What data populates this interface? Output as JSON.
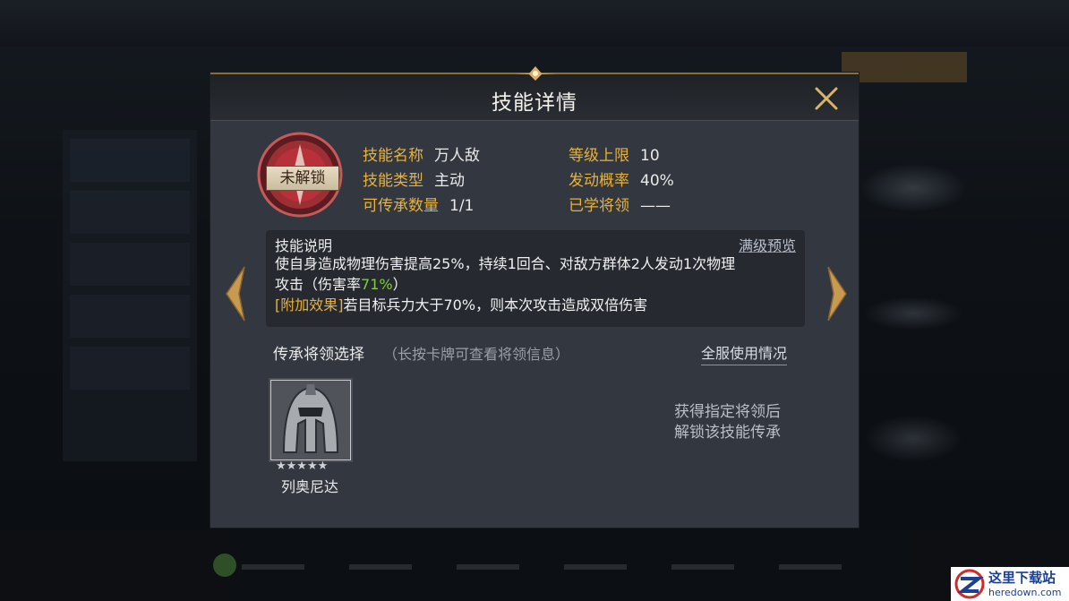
{
  "modal": {
    "title": "技能详情"
  },
  "skill": {
    "lock_label": "未解锁",
    "name_key": "技能名称",
    "name_val": "万人敌",
    "type_key": "技能类型",
    "type_val": "主动",
    "inherit_key": "可传承数量",
    "inherit_val": "1/1",
    "level_key": "等级上限",
    "level_val": "10",
    "chance_key": "发动概率",
    "chance_val": "40%",
    "learned_key": "已学将领",
    "learned_val": "——"
  },
  "description": {
    "title": "技能说明",
    "preview_link": "满级预览",
    "line1": "使自身造成物理伤害提高25%，持续1回合、对敌方群体2人发动1次物理",
    "line2_prefix": "攻击（伤害率",
    "line2_rate": "71%",
    "line2_suffix": "）",
    "extra_tag": "[附加效果]",
    "extra_text": "若目标兵力大于70%，则本次攻击造成双倍伤害"
  },
  "inheritance": {
    "title": "传承将领选择",
    "hint": "（长按卡牌可查看将领信息）",
    "server_usage": "全服使用情况",
    "hero_name": "列奥尼达",
    "stars": "★★★★★",
    "star_count": 5,
    "unlock_note_line1": "获得指定将领后",
    "unlock_note_line2": "解锁该技能传承"
  },
  "watermark": {
    "text": "这里下载站",
    "sub": "heredown.com"
  },
  "colors": {
    "accent_gold": "#e6b23d",
    "rate_green": "#7fce3a",
    "lock_red": "#b8313a"
  }
}
